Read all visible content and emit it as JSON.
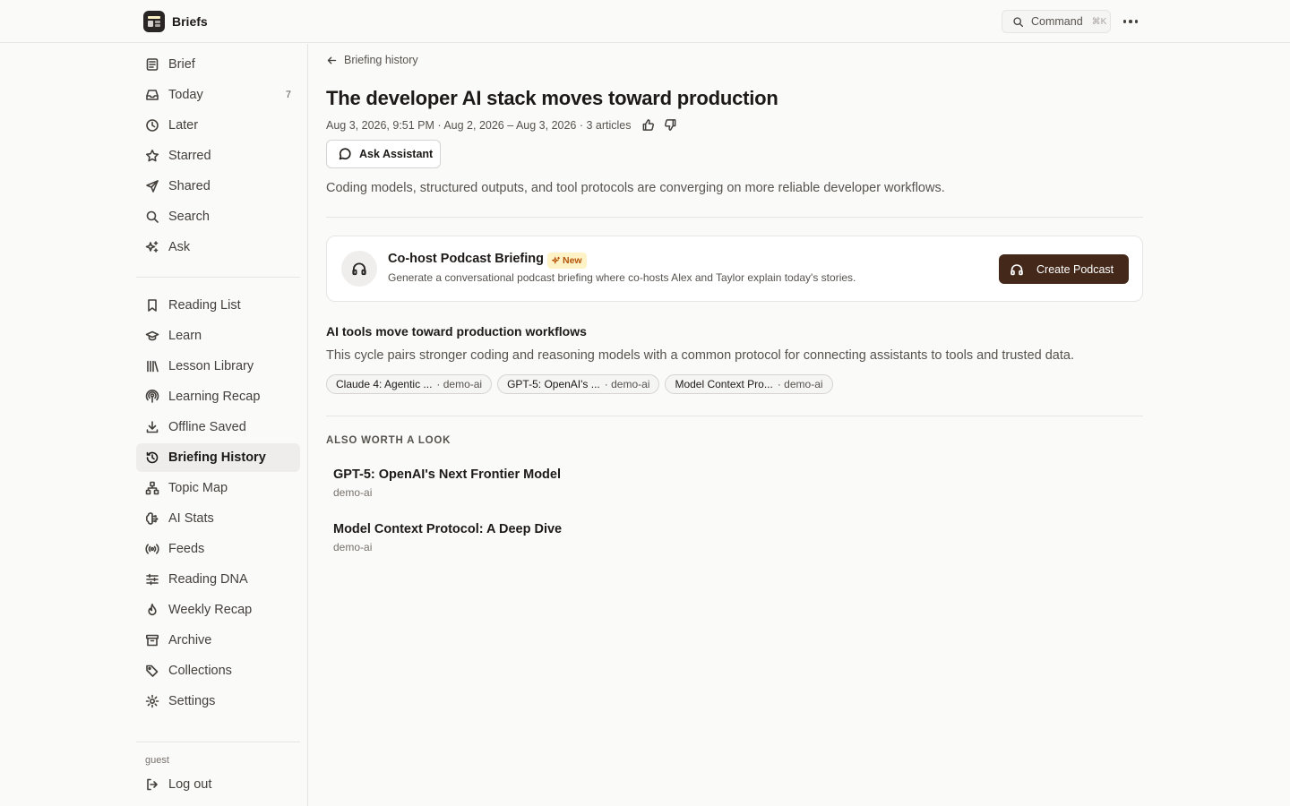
{
  "header": {
    "app_name": "Briefs",
    "command_label": "Command",
    "command_shortcut": "⌘K"
  },
  "sidebar": {
    "primary": [
      {
        "label": "Brief",
        "icon": "newspaper-icon"
      },
      {
        "label": "Today",
        "icon": "inbox-icon",
        "badge": "7"
      },
      {
        "label": "Later",
        "icon": "clock-icon"
      },
      {
        "label": "Starred",
        "icon": "star-icon"
      },
      {
        "label": "Shared",
        "icon": "send-icon"
      },
      {
        "label": "Search",
        "icon": "search-icon"
      },
      {
        "label": "Ask",
        "icon": "sparkles-icon"
      }
    ],
    "secondary": [
      {
        "label": "Reading List",
        "icon": "bookmark-icon"
      },
      {
        "label": "Learn",
        "icon": "graduation-cap-icon"
      },
      {
        "label": "Lesson Library",
        "icon": "library-icon"
      },
      {
        "label": "Learning Recap",
        "icon": "podcast-icon"
      },
      {
        "label": "Offline Saved",
        "icon": "download-icon"
      },
      {
        "label": "Briefing History",
        "icon": "history-icon",
        "active": true
      },
      {
        "label": "Topic Map",
        "icon": "network-icon"
      },
      {
        "label": "AI Stats",
        "icon": "brain-icon"
      },
      {
        "label": "Feeds",
        "icon": "radio-icon"
      },
      {
        "label": "Reading DNA",
        "icon": "sliders-icon"
      },
      {
        "label": "Weekly Recap",
        "icon": "flame-icon"
      },
      {
        "label": "Archive",
        "icon": "archive-icon"
      },
      {
        "label": "Collections",
        "icon": "tag-icon"
      },
      {
        "label": "Settings",
        "icon": "gear-icon"
      }
    ],
    "user": "guest",
    "logout_label": "Log out"
  },
  "main": {
    "back_label": "Briefing history",
    "title": "The developer AI stack moves toward production",
    "meta": "Aug 3, 2026, 9:51 PM · Aug 2, 2026 – Aug 3, 2026 · 3 articles",
    "ask_label": "Ask Assistant",
    "summary": "Coding models, structured outputs, and tool protocols are converging on more reliable developer workflows.",
    "podcast": {
      "title": "Co-host Podcast Briefing",
      "badge": "New",
      "description": "Generate a conversational podcast briefing where co-hosts Alex and Taylor explain today's stories.",
      "button_label": "Create Podcast"
    },
    "section": {
      "title": "AI tools move toward production workflows",
      "description": "This cycle pairs stronger coding and reasoning models with a common protocol for connecting assistants to tools and trusted data.",
      "chips": [
        {
          "title": "Claude 4: Agentic ...",
          "source": "· demo-ai"
        },
        {
          "title": "GPT-5: OpenAI's ...",
          "source": "· demo-ai"
        },
        {
          "title": "Model Context Pro...",
          "source": "· demo-ai"
        }
      ]
    },
    "also_heading": "ALSO WORTH A LOOK",
    "also": [
      {
        "title": "GPT-5: OpenAI's Next Frontier Model",
        "source": "demo-ai"
      },
      {
        "title": "Model Context Protocol: A Deep Dive",
        "source": "demo-ai"
      }
    ]
  },
  "colors": {
    "background": "#fafaf9",
    "active_item": "#efedeb",
    "primary_button": "#44291b",
    "new_badge_bg": "#fef3c7",
    "new_badge_text": "#b45309"
  }
}
